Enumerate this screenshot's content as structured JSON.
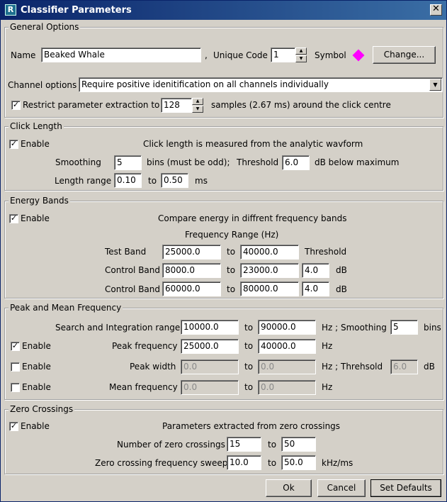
{
  "window": {
    "title": "Classifier Parameters",
    "close_glyph": "✕",
    "app_icon_glyph": "R"
  },
  "general": {
    "legend": "General Options",
    "name_label": "Name",
    "name_value": "Beaked Whale",
    "comma": ",",
    "unique_code_label": "Unique Code",
    "unique_code_value": "1",
    "symbol_label": "Symbol",
    "symbol_color": "#ff00ff",
    "change_button": "Change...",
    "channel_label": "Channel options",
    "channel_value": "Require positive idenitification on all channels individually",
    "restrict_checked": true,
    "restrict_label": "Restrict parameter extraction to",
    "restrict_value": "128",
    "restrict_suffix": "samples  (2.67 ms)  around the click centre"
  },
  "click_length": {
    "legend": "Click Length",
    "enable_checked": true,
    "enable_label": "Enable",
    "description": "Click length is measured from the analytic wavform",
    "smoothing_label": "Smoothing",
    "smoothing_value": "5",
    "bins_note": "bins (must be odd);",
    "threshold_label": "Threshold",
    "threshold_value": "6.0",
    "threshold_suffix": "dB below maximum",
    "length_range_label": "Length range",
    "length_min": "0.10",
    "to": "to",
    "length_max": "0.50",
    "length_unit": "ms"
  },
  "energy_bands": {
    "legend": "Energy Bands",
    "enable_checked": true,
    "enable_label": "Enable",
    "description": "Compare energy in diffrent frequency bands",
    "freq_range_label": "Frequency Range (Hz)",
    "threshold_header": "Threshold",
    "to": "to",
    "unit": "dB",
    "rows": [
      {
        "label": "Test Band",
        "low": "25000.0",
        "high": "40000.0"
      },
      {
        "label": "Control Band",
        "low": "8000.0",
        "high": "23000.0",
        "threshold": "4.0"
      },
      {
        "label": "Control Band",
        "low": "60000.0",
        "high": "80000.0",
        "threshold": "4.0"
      }
    ]
  },
  "peak_mean": {
    "legend": "Peak and Mean Frequency",
    "search_label": "Search and Integration range",
    "search_low": "10000.0",
    "search_high": "90000.0",
    "to": "to",
    "hz_smoothing": "Hz ; Smoothing",
    "smoothing_value": "5",
    "bins": "bins",
    "enable_label": "Enable",
    "peak_freq_checked": true,
    "peak_freq_label": "Peak frequency",
    "peak_freq_low": "25000.0",
    "peak_freq_high": "40000.0",
    "hz": "Hz",
    "peak_width_checked": false,
    "peak_width_label": "Peak width",
    "peak_width_low": "0.0",
    "peak_width_high": "0.0",
    "hz_threshold": "Hz ; Threhsold",
    "peak_width_threshold": "6.0",
    "db": "dB",
    "mean_freq_checked": false,
    "mean_freq_label": "Mean frequency",
    "mean_freq_low": "0.0",
    "mean_freq_high": "0.0"
  },
  "zero_crossings": {
    "legend": "Zero Crossings",
    "enable_checked": true,
    "enable_label": "Enable",
    "description": "Parameters extracted from zero crossings",
    "count_label": "Number of zero crossings",
    "count_min": "15",
    "count_max": "50",
    "to": "to",
    "sweep_label": "Zero crossing frequency sweep",
    "sweep_min": "10.0",
    "sweep_max": "50.0",
    "sweep_unit": "kHz/ms"
  },
  "buttons": {
    "ok": "Ok",
    "cancel": "Cancel",
    "defaults": "Set Defaults"
  }
}
